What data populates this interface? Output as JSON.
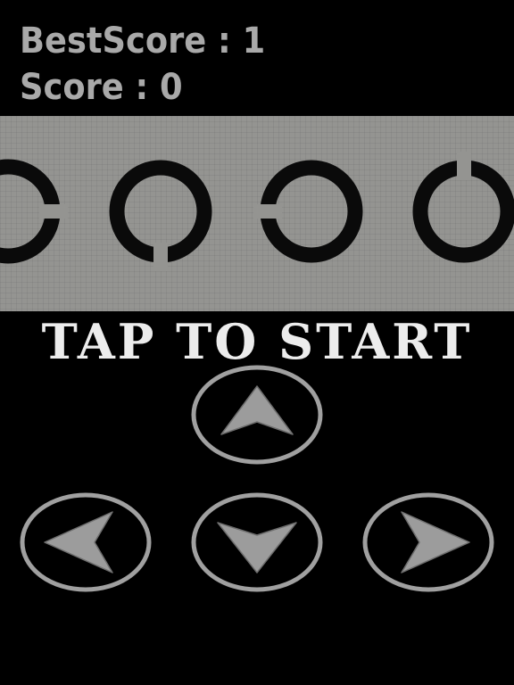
{
  "hud": {
    "best_score_label": "BestScore",
    "best_score_value": "1",
    "score_label": "Score",
    "score_value": "0",
    "separator": " : "
  },
  "prompt": {
    "text": "TAP TO START"
  },
  "track": {
    "rings": [
      {
        "gap": "right"
      },
      {
        "gap": "down"
      },
      {
        "gap": "left"
      },
      {
        "gap": "up"
      }
    ]
  },
  "controls": {
    "buttons": [
      {
        "name": "up-button",
        "icon": "arrow-up-icon",
        "direction": "up"
      },
      {
        "name": "left-button",
        "icon": "arrow-left-icon",
        "direction": "left"
      },
      {
        "name": "down-button",
        "icon": "arrow-down-icon",
        "direction": "down"
      },
      {
        "name": "right-button",
        "icon": "arrow-right-icon",
        "direction": "right"
      }
    ]
  },
  "colors": {
    "background": "#000000",
    "hud_text": "#a9a9a9",
    "track": "#949491",
    "ring": "#0a0a0a",
    "prompt_text": "#ececec",
    "button_outline": "#a0a0a0",
    "arrow": "#9c9c9c"
  }
}
